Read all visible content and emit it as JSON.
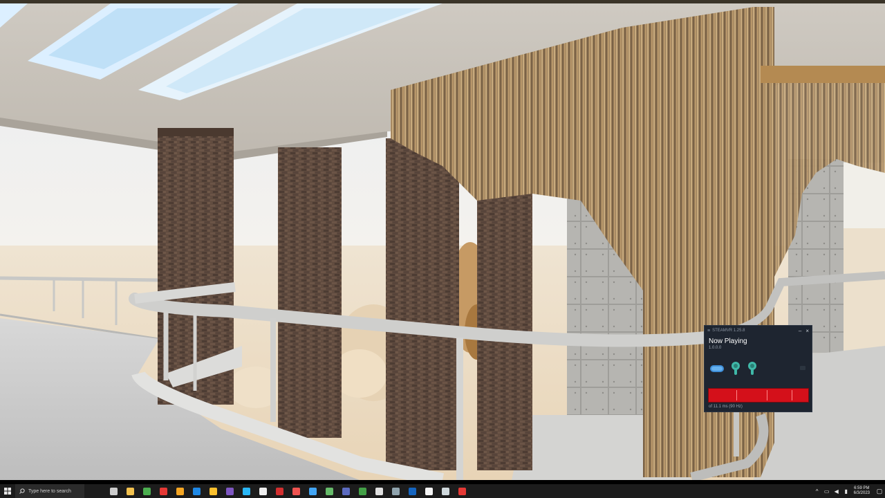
{
  "steamvr": {
    "app_title": "STEAMVR 1.25.8",
    "menu_icon": "hamburger-icon",
    "minimize_label": "–",
    "close_label": "×",
    "now_playing": "Now Playing",
    "version": "1.0.0.0",
    "devices": [
      "headset-icon",
      "controller-left-icon",
      "controller-right-icon"
    ],
    "frame_time": "of 11.1 ms (90 Hz)",
    "perf_color": "#d4101a"
  },
  "taskbar": {
    "search_placeholder": "Type here to search",
    "apps": [
      {
        "name": "task-view",
        "color": "#cccccc"
      },
      {
        "name": "file-explorer",
        "color": "#f2c14e"
      },
      {
        "name": "chrome",
        "color": "#4caf50"
      },
      {
        "name": "red-app",
        "color": "#e53935"
      },
      {
        "name": "folder",
        "color": "#f5a623"
      },
      {
        "name": "vscode",
        "color": "#1e88e5"
      },
      {
        "name": "yellow-app",
        "color": "#fbc02d"
      },
      {
        "name": "visual-studio",
        "color": "#7e57c2"
      },
      {
        "name": "blue-app",
        "color": "#29b6f6"
      },
      {
        "name": "github",
        "color": "#eeeeee"
      },
      {
        "name": "acrobat",
        "color": "#d32f2f"
      },
      {
        "name": "app-12",
        "color": "#ef5350"
      },
      {
        "name": "app-13",
        "color": "#42a5f5"
      },
      {
        "name": "chrome-2",
        "color": "#66bb6a"
      },
      {
        "name": "app-15",
        "color": "#5c6bc0"
      },
      {
        "name": "chrome-3",
        "color": "#43a047"
      },
      {
        "name": "app-17",
        "color": "#e0e0e0"
      },
      {
        "name": "app-18",
        "color": "#90a4ae"
      },
      {
        "name": "app-19",
        "color": "#1565c0"
      },
      {
        "name": "epic-unreal",
        "color": "#f5f5f5"
      },
      {
        "name": "app-21",
        "color": "#cfd8dc"
      },
      {
        "name": "record-app",
        "color": "#e53935"
      }
    ],
    "tray": {
      "chevron": "^",
      "network": "▭",
      "volume": "◀",
      "battery": "▮",
      "time": "6:59 PM",
      "date": "6/3/2023",
      "notifications": "▢"
    }
  }
}
